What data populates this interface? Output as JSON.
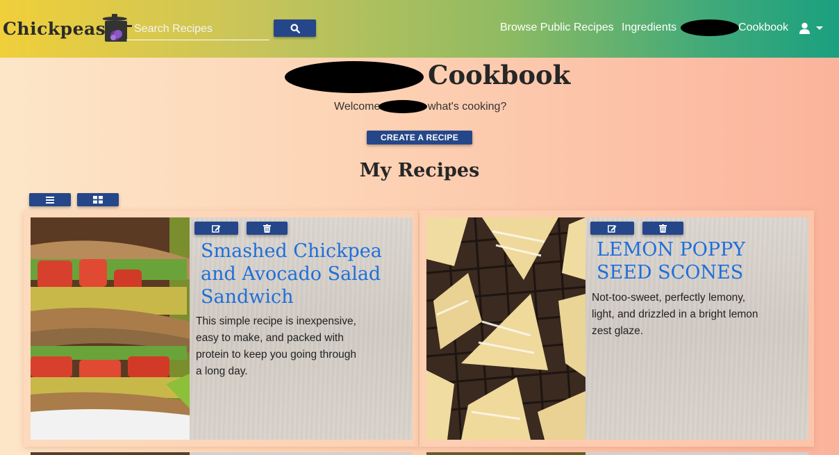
{
  "navbar": {
    "brand": "Chickpeas",
    "search": {
      "placeholder": "Search Recipes",
      "value": ""
    },
    "links": {
      "browse": "Browse Public Recipes",
      "ingredients": "Ingredients",
      "cookbook": "Cookbook"
    }
  },
  "header": {
    "title": "Cookbook",
    "welcome_prefix": "Welcome",
    "welcome_suffix": "what's cooking?",
    "create_button": "CREATE A RECIPE"
  },
  "section": {
    "title": "My Recipes"
  },
  "recipes": [
    {
      "title": "Smashed Chickpea and Avocado Salad Sandwich",
      "description": "This simple recipe is inexpensive, easy to make, and packed with protein to keep you going through a long day."
    },
    {
      "title": "LEMON POPPY SEED SCONES",
      "description": "Not-too-sweet, perfectly lemony, light, and drizzled in a bright lemon zest glaze."
    }
  ],
  "icons": {
    "search": "search-icon",
    "user": "user-icon",
    "list_view": "list-view-icon",
    "grid_view": "grid-view-icon",
    "edit": "edit-icon",
    "delete": "trash-icon"
  },
  "colors": {
    "primary_button": "#25478a",
    "recipe_title": "#1e6fd9"
  }
}
